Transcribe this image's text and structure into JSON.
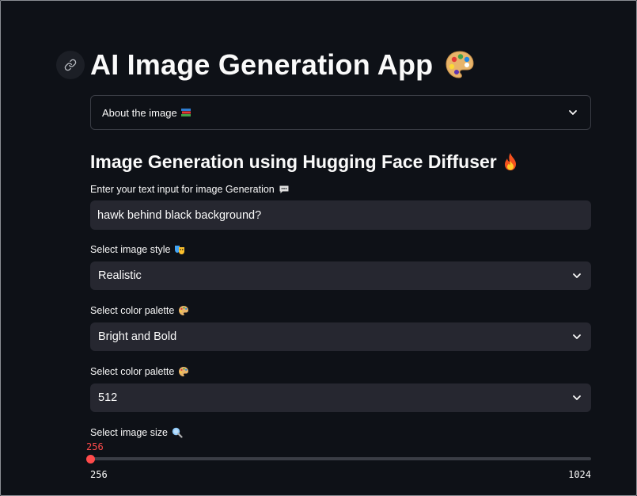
{
  "app": {
    "title": "AI Image Generation App"
  },
  "expander": {
    "label": "About the image"
  },
  "subheader": "Image Generation using Hugging Face Diffuser",
  "text_input": {
    "label": "Enter your text input for image Generation",
    "value": "hawk behind black background?"
  },
  "style_select": {
    "label": "Select image style",
    "value": "Realistic"
  },
  "palette_select": {
    "label": "Select color palette",
    "value": "Bright and Bold"
  },
  "resolution_select": {
    "label": "Select color palette",
    "value": "512"
  },
  "size_slider": {
    "label": "Select image size",
    "value": "256",
    "min": "256",
    "max": "1024"
  },
  "colors": {
    "background": "#0e1117",
    "widget": "#262730",
    "accent": "#ff4b4b",
    "text": "#fafafa"
  }
}
